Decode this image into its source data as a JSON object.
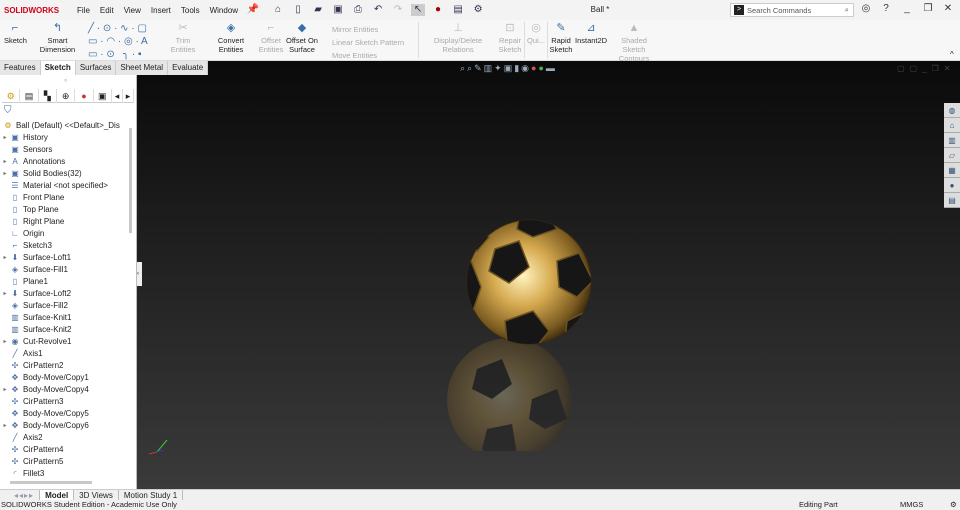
{
  "app": {
    "logo": "SOLIDWORKS",
    "title": "Ball *"
  },
  "menu": [
    "File",
    "Edit",
    "View",
    "Insert",
    "Tools",
    "Window"
  ],
  "search": {
    "placeholder": "Search Commands"
  },
  "ribbon": {
    "sketch": "Sketch",
    "smart_dimension": "Smart Dimension",
    "trim": "Trim Entities",
    "convert": "Convert Entities",
    "offset": "Offset Entities",
    "offset_surface": "Offset On Surface",
    "mirror": "Mirror Entities",
    "linear_pattern": "Linear Sketch Pattern",
    "move": "Move Entities",
    "relations": "Display/Delete Relations",
    "repair": "Repair Sketch",
    "quick": "Qui...",
    "rapid": "Rapid Sketch",
    "instant2d": "Instant2D",
    "shaded": "Shaded Sketch Contours"
  },
  "command_tabs": [
    "Features",
    "Sketch",
    "Surfaces",
    "Sheet Metal",
    "Evaluate"
  ],
  "active_command_tab": "Sketch",
  "tree": [
    {
      "label": "Ball (Default) <<Default>_Dis",
      "icon": "part-icon",
      "expand": false
    },
    {
      "label": "History",
      "icon": "folder-icon",
      "expand": true
    },
    {
      "label": "Sensors",
      "icon": "folder-icon",
      "expand": false
    },
    {
      "label": "Annotations",
      "icon": "annotations-icon",
      "expand": true
    },
    {
      "label": "Solid Bodies(32)",
      "icon": "folder-icon",
      "expand": true
    },
    {
      "label": "Material <not specified>",
      "icon": "material-icon",
      "expand": false
    },
    {
      "label": "Front Plane",
      "icon": "plane-icon",
      "expand": false
    },
    {
      "label": "Top Plane",
      "icon": "plane-icon",
      "expand": false
    },
    {
      "label": "Right Plane",
      "icon": "plane-icon",
      "expand": false
    },
    {
      "label": "Origin",
      "icon": "origin-icon",
      "expand": false
    },
    {
      "label": "Sketch3",
      "icon": "sketch-icon",
      "expand": false
    },
    {
      "label": "Surface-Loft1",
      "icon": "loft-icon",
      "expand": true
    },
    {
      "label": "Surface-Fill1",
      "icon": "fill-icon",
      "expand": false
    },
    {
      "label": "Plane1",
      "icon": "plane-icon",
      "expand": false
    },
    {
      "label": "Surface-Loft2",
      "icon": "loft-icon",
      "expand": true
    },
    {
      "label": "Surface-Fill2",
      "icon": "fill-icon",
      "expand": false
    },
    {
      "label": "Surface-Knit1",
      "icon": "knit-icon",
      "expand": false
    },
    {
      "label": "Surface-Knit2",
      "icon": "knit-icon",
      "expand": false
    },
    {
      "label": "Cut-Revolve1",
      "icon": "revolve-icon",
      "expand": true
    },
    {
      "label": "Axis1",
      "icon": "axis-icon",
      "expand": false
    },
    {
      "label": "CirPattern2",
      "icon": "pattern-icon",
      "expand": false
    },
    {
      "label": "Body-Move/Copy1",
      "icon": "move-icon",
      "expand": false
    },
    {
      "label": "Body-Move/Copy4",
      "icon": "move-icon",
      "expand": true
    },
    {
      "label": "CirPattern3",
      "icon": "pattern-icon",
      "expand": false
    },
    {
      "label": "Body-Move/Copy5",
      "icon": "move-icon",
      "expand": false
    },
    {
      "label": "Body-Move/Copy6",
      "icon": "move-icon",
      "expand": true
    },
    {
      "label": "Axis2",
      "icon": "axis-icon",
      "expand": false
    },
    {
      "label": "CirPattern4",
      "icon": "pattern-icon",
      "expand": false
    },
    {
      "label": "CirPattern5",
      "icon": "pattern-icon",
      "expand": false
    },
    {
      "label": "Fillet3",
      "icon": "fillet-icon",
      "expand": false
    }
  ],
  "bottom_tabs": [
    "Model",
    "3D Views",
    "Motion Study 1"
  ],
  "status": {
    "left": "SOLIDWORKS Student Edition - Academic Use Only",
    "mode": "Editing Part",
    "units": "MMGS"
  },
  "colors": {
    "accent": "#d0021b",
    "ball_gold": "#c9a44a",
    "viewport": "#1e1e1e"
  }
}
